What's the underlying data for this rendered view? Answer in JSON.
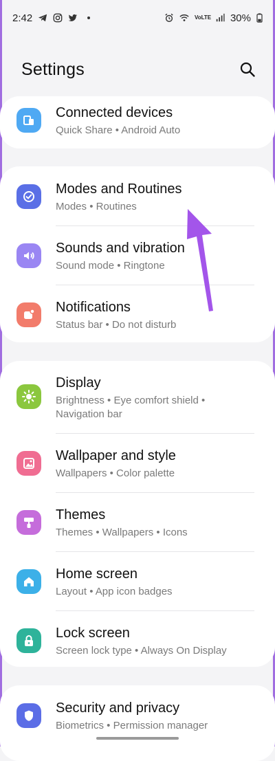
{
  "status_bar": {
    "time": "2:42",
    "icons_left": [
      "telegram-icon",
      "instagram-icon",
      "twitter-icon"
    ],
    "icons_right": [
      "alarm-icon",
      "wifi-icon",
      "volte-icon",
      "signal-icon"
    ],
    "volte_label": "VoLTE",
    "battery": "30%"
  },
  "header": {
    "title": "Settings",
    "search_icon": "search-icon"
  },
  "groups": [
    {
      "items": [
        {
          "title": "Connected devices",
          "subtitle": "Quick Share  •  Android Auto",
          "icon": "connected-devices-icon",
          "color": "#4fa9f3"
        }
      ]
    },
    {
      "items": [
        {
          "title": "Modes and Routines",
          "subtitle": "Modes  •  Routines",
          "icon": "modes-routines-icon",
          "color": "#5a6fe6"
        },
        {
          "title": "Sounds and vibration",
          "subtitle": "Sound mode  •  Ringtone",
          "icon": "sound-icon",
          "color": "#9a86f3"
        },
        {
          "title": "Notifications",
          "subtitle": "Status bar  •  Do not disturb",
          "icon": "notifications-icon",
          "color": "#f27c6b"
        }
      ]
    },
    {
      "items": [
        {
          "title": "Display",
          "subtitle": "Brightness  •  Eye comfort shield  •",
          "subtitle2": "Navigation bar",
          "icon": "display-icon",
          "color": "#8bc73e"
        },
        {
          "title": "Wallpaper and style",
          "subtitle": "Wallpapers  •  Color palette",
          "icon": "wallpaper-icon",
          "color": "#f06d92"
        },
        {
          "title": "Themes",
          "subtitle": "Themes  •  Wallpapers  •  Icons",
          "icon": "themes-icon",
          "color": "#c56ddb"
        },
        {
          "title": "Home screen",
          "subtitle": "Layout  •  App icon badges",
          "icon": "home-icon",
          "color": "#3cb0e8"
        },
        {
          "title": "Lock screen",
          "subtitle": "Screen lock type  •  Always On Display",
          "icon": "lock-icon",
          "color": "#2eb39a"
        }
      ]
    },
    {
      "items": [
        {
          "title": "Security and privacy",
          "subtitle": "Biometrics  •  Permission manager",
          "icon": "security-icon",
          "color": "#5b6de6"
        }
      ]
    }
  ],
  "annotation": {
    "arrow_color": "#a355ea"
  }
}
